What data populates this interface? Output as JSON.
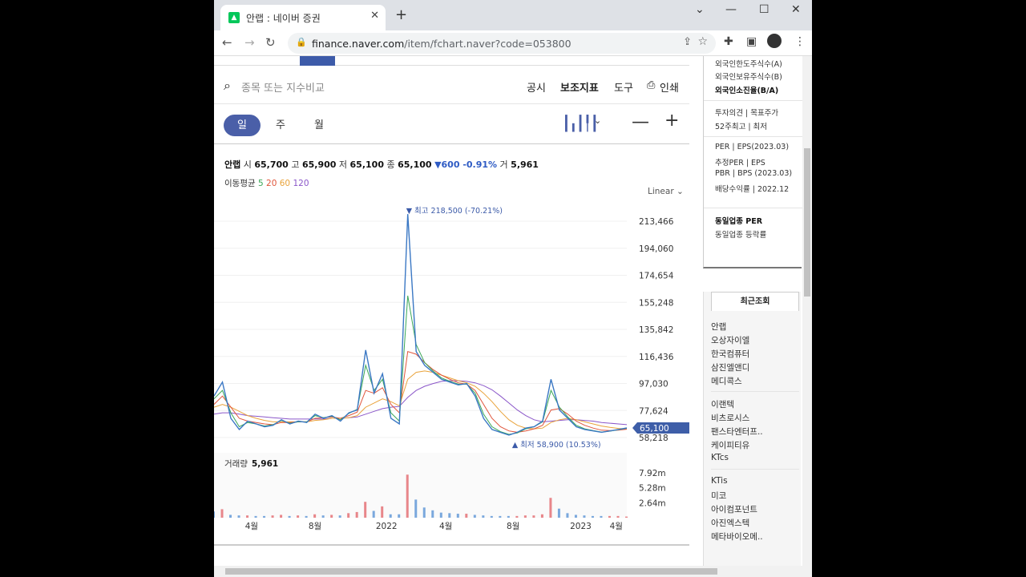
{
  "browser": {
    "tab_title": "안랩 : 네이버 증권",
    "url_host": "finance.naver.com",
    "url_path": "/item/fchart.naver?code=053800"
  },
  "toolbar": {
    "search_placeholder": "종목 또는 지수비교",
    "menu": [
      "공시",
      "보조지표",
      "도구",
      "인쇄"
    ]
  },
  "periods": [
    "일",
    "주",
    "월"
  ],
  "stock": {
    "name": "안랩",
    "open_label": "시",
    "open": "65,700",
    "high_label": "고",
    "high": "65,900",
    "low_label": "저",
    "low": "65,100",
    "close_label": "종",
    "close": "65,100",
    "change": "▼600 -0.91%",
    "volume_label": "거",
    "volume": "5,961"
  },
  "moving_average": {
    "label": "이동평균",
    "periods": [
      "5",
      "20",
      "60",
      "120"
    ],
    "colors": [
      "#3aa757",
      "#e0553b",
      "#e9a33b",
      "#8b57c9"
    ]
  },
  "scale_mode": "Linear",
  "chart_data": {
    "type": "line",
    "y_ticks": [
      "213,466",
      "194,060",
      "174,654",
      "155,248",
      "135,842",
      "116,436",
      "97,030",
      "77,624",
      "58,218"
    ],
    "ylim": [
      58218,
      213466
    ],
    "x_ticks": [
      "4월",
      "8월",
      "2022",
      "4월",
      "8월",
      "2023",
      "4월"
    ],
    "current_price_tag": "65,100",
    "max_annotation": "▼ 최고 218,500 (-70.21%)",
    "min_annotation": "▲ 최저 58,900 (10.53%)",
    "volume_label": "거래량",
    "volume_value": "5,961",
    "volume_ticks": [
      "7.92m",
      "5.28m",
      "2.64m"
    ],
    "series": [
      {
        "name": "price",
        "color": "#3b78c4",
        "values": [
          88000,
          98000,
          72000,
          64000,
          70000,
          68000,
          66000,
          67000,
          71000,
          68000,
          70000,
          69000,
          75000,
          72000,
          74000,
          70000,
          76000,
          78000,
          121000,
          90000,
          104000,
          72000,
          68000,
          218500,
          120000,
          110000,
          105000,
          100000,
          98000,
          96000,
          97000,
          88000,
          72000,
          64000,
          62000,
          60000,
          62000,
          65000,
          66000,
          70000,
          100000,
          78000,
          72000,
          66000,
          64000,
          63000,
          62000,
          63000,
          64000,
          65100
        ]
      },
      {
        "name": "5",
        "color": "#3aa757",
        "values": [
          86000,
          92000,
          76000,
          66000,
          69000,
          68000,
          66500,
          67500,
          70500,
          68500,
          69500,
          69500,
          74000,
          72500,
          73500,
          71000,
          75500,
          78500,
          110000,
          92000,
          100000,
          76000,
          70000,
          160000,
          125000,
          112000,
          106000,
          101000,
          98500,
          96500,
          96500,
          90000,
          75000,
          66000,
          62500,
          60500,
          61500,
          64500,
          66000,
          69500,
          92000,
          80000,
          73000,
          67000,
          64500,
          63200,
          62200,
          62800,
          63800,
          64900
        ]
      },
      {
        "name": "20",
        "color": "#e0553b",
        "values": [
          82000,
          88000,
          80000,
          72000,
          70000,
          69000,
          68000,
          67500,
          69000,
          69000,
          69500,
          69500,
          72000,
          72500,
          73000,
          72000,
          74000,
          76500,
          92000,
          90000,
          94000,
          82000,
          76000,
          120000,
          118000,
          112000,
          107000,
          103000,
          100000,
          97500,
          96500,
          92000,
          82000,
          72000,
          66000,
          63000,
          62000,
          63000,
          64500,
          67000,
          78000,
          79000,
          75000,
          70000,
          67000,
          65000,
          63500,
          63200,
          63500,
          64200
        ]
      },
      {
        "name": "60",
        "color": "#e9a33b",
        "values": [
          80000,
          82000,
          80000,
          77000,
          74000,
          72000,
          70500,
          69500,
          69500,
          69500,
          69500,
          69500,
          70500,
          71000,
          72000,
          72000,
          72500,
          74000,
          80000,
          83000,
          86000,
          84000,
          81000,
          100000,
          105000,
          106000,
          105000,
          103000,
          101000,
          99000,
          97500,
          95000,
          90000,
          84000,
          77000,
          71000,
          67000,
          65000,
          64500,
          65000,
          69000,
          71000,
          72000,
          71000,
          69500,
          68000,
          66500,
          65500,
          64800,
          64500
        ]
      },
      {
        "name": "120",
        "color": "#8b57c9",
        "values": [
          75000,
          76000,
          76000,
          75000,
          74000,
          73500,
          73000,
          72500,
          72000,
          71500,
          71500,
          71500,
          71500,
          71500,
          72000,
          72000,
          72500,
          73000,
          75000,
          77000,
          79000,
          80000,
          80500,
          87000,
          92000,
          95000,
          97000,
          98500,
          99000,
          99000,
          98500,
          97500,
          95500,
          92500,
          88000,
          83000,
          78000,
          74000,
          71000,
          69500,
          70000,
          70500,
          71000,
          71000,
          70500,
          70000,
          69000,
          68500,
          68000,
          67500
        ]
      }
    ],
    "volume": [
      1.1,
      1.5,
      0.5,
      0.4,
      0.4,
      0.3,
      0.3,
      0.4,
      0.5,
      0.3,
      0.4,
      0.3,
      0.6,
      0.4,
      0.5,
      0.4,
      0.8,
      1.0,
      2.8,
      1.2,
      2.0,
      0.6,
      0.6,
      7.6,
      3.2,
      1.8,
      1.3,
      0.9,
      0.8,
      0.7,
      0.7,
      0.5,
      0.4,
      0.3,
      0.3,
      0.3,
      0.3,
      0.4,
      0.4,
      0.6,
      3.5,
      1.6,
      0.8,
      0.5,
      0.4,
      0.3,
      0.3,
      0.3,
      0.3,
      0.2
    ]
  },
  "sidebar": {
    "lines_top": [
      "외국인한도주식수(A)",
      "외국인보유주식수(B)",
      "외국인소진율(B/A)"
    ],
    "lines_mid": [
      "투자의견 | 목표주가",
      "52주최고 | 최저"
    ],
    "lines_per": [
      "PER | EPS(2023.03)",
      "추정PER | EPS",
      "PBR | BPS (2023.03)",
      "배당수익률 | 2022.12"
    ],
    "lines_bottom": [
      "동일업종 PER",
      "동일업종 등락률"
    ],
    "recent_header": "최근조회",
    "recent": [
      "안랩",
      "오상자이엘",
      "한국컴퓨터",
      "삼진엘앤디",
      "메디콕스",
      "이랜텍",
      "비츠로시스",
      "팬스타엔터프..",
      "케이피티유",
      "KTcs",
      "KTis",
      "미코",
      "아이컴포넌트",
      "아진엑스텍",
      "메타바이오메.."
    ]
  }
}
